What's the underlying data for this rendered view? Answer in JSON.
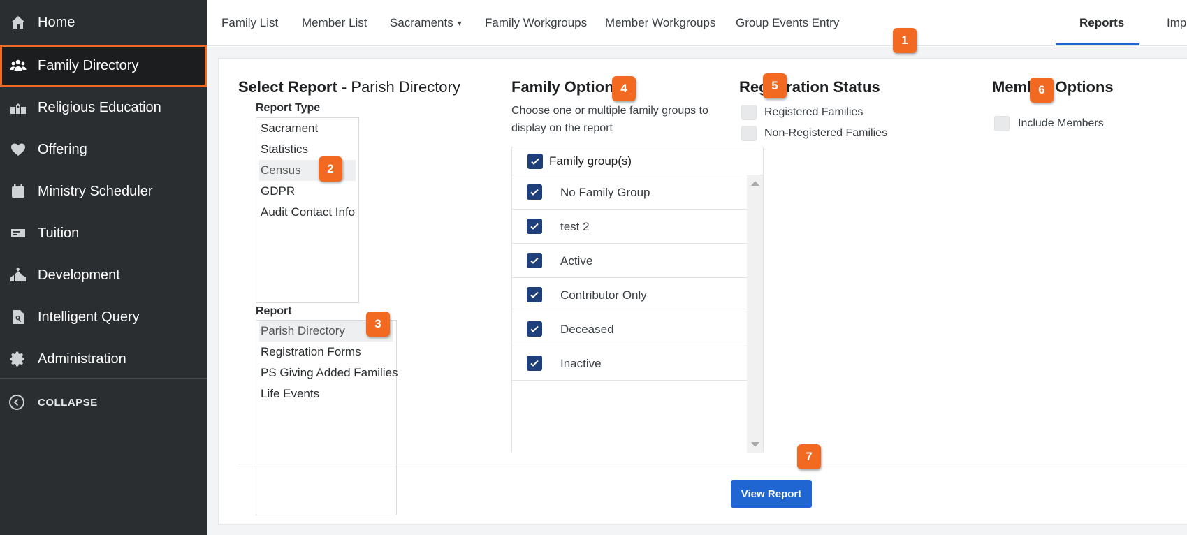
{
  "sidebar": {
    "items": [
      {
        "label": "Home",
        "icon": "home-icon"
      },
      {
        "label": "Family Directory",
        "icon": "people-icon"
      },
      {
        "label": "Religious Education",
        "icon": "school-icon"
      },
      {
        "label": "Offering",
        "icon": "heart-icon"
      },
      {
        "label": "Ministry Scheduler",
        "icon": "calendar-icon"
      },
      {
        "label": "Tuition",
        "icon": "ticket-icon"
      },
      {
        "label": "Development",
        "icon": "church-icon"
      },
      {
        "label": "Intelligent Query",
        "icon": "search-document-icon"
      },
      {
        "label": "Administration",
        "icon": "gear-icon"
      }
    ],
    "collapse_label": "COLLAPSE"
  },
  "nav": {
    "tabs": [
      "Family List",
      "Member List",
      "Sacraments",
      "Family Workgroups",
      "Member Workgroups",
      "Group Events Entry",
      "Reports",
      "Import"
    ],
    "sacraments_caret": "▾"
  },
  "select_report": {
    "title": "Select Report",
    "separator": " - ",
    "current": "Parish Directory",
    "report_type_label": "Report Type",
    "report_types": [
      "Sacrament",
      "Statistics",
      "Census",
      "GDPR",
      "Audit Contact Info"
    ],
    "report_label": "Report",
    "reports": [
      "Parish Directory",
      "Registration Forms",
      "PS Giving Added Families",
      "Life Events"
    ]
  },
  "family_options": {
    "title": "Family Options",
    "description": "Choose one or multiple family groups to display on the report",
    "header": "Family group(s)",
    "groups": [
      "No Family Group",
      "test 2",
      "Active",
      "Contributor Only",
      "Deceased",
      "Inactive"
    ]
  },
  "registration_status": {
    "title": "Registration Status",
    "options": [
      "Registered Families",
      "Non-Registered Families"
    ]
  },
  "member_options": {
    "title": "Member Options",
    "include_members": "Include Members"
  },
  "view_report_label": "View Report",
  "callouts": [
    "1",
    "2",
    "3",
    "4",
    "5",
    "6",
    "7"
  ],
  "colors": {
    "sidebar_bg": "#2b2e30",
    "accent_orange": "#f26a21",
    "primary_blue": "#1f66d3",
    "checkbox_navy": "#1f3f7a"
  }
}
